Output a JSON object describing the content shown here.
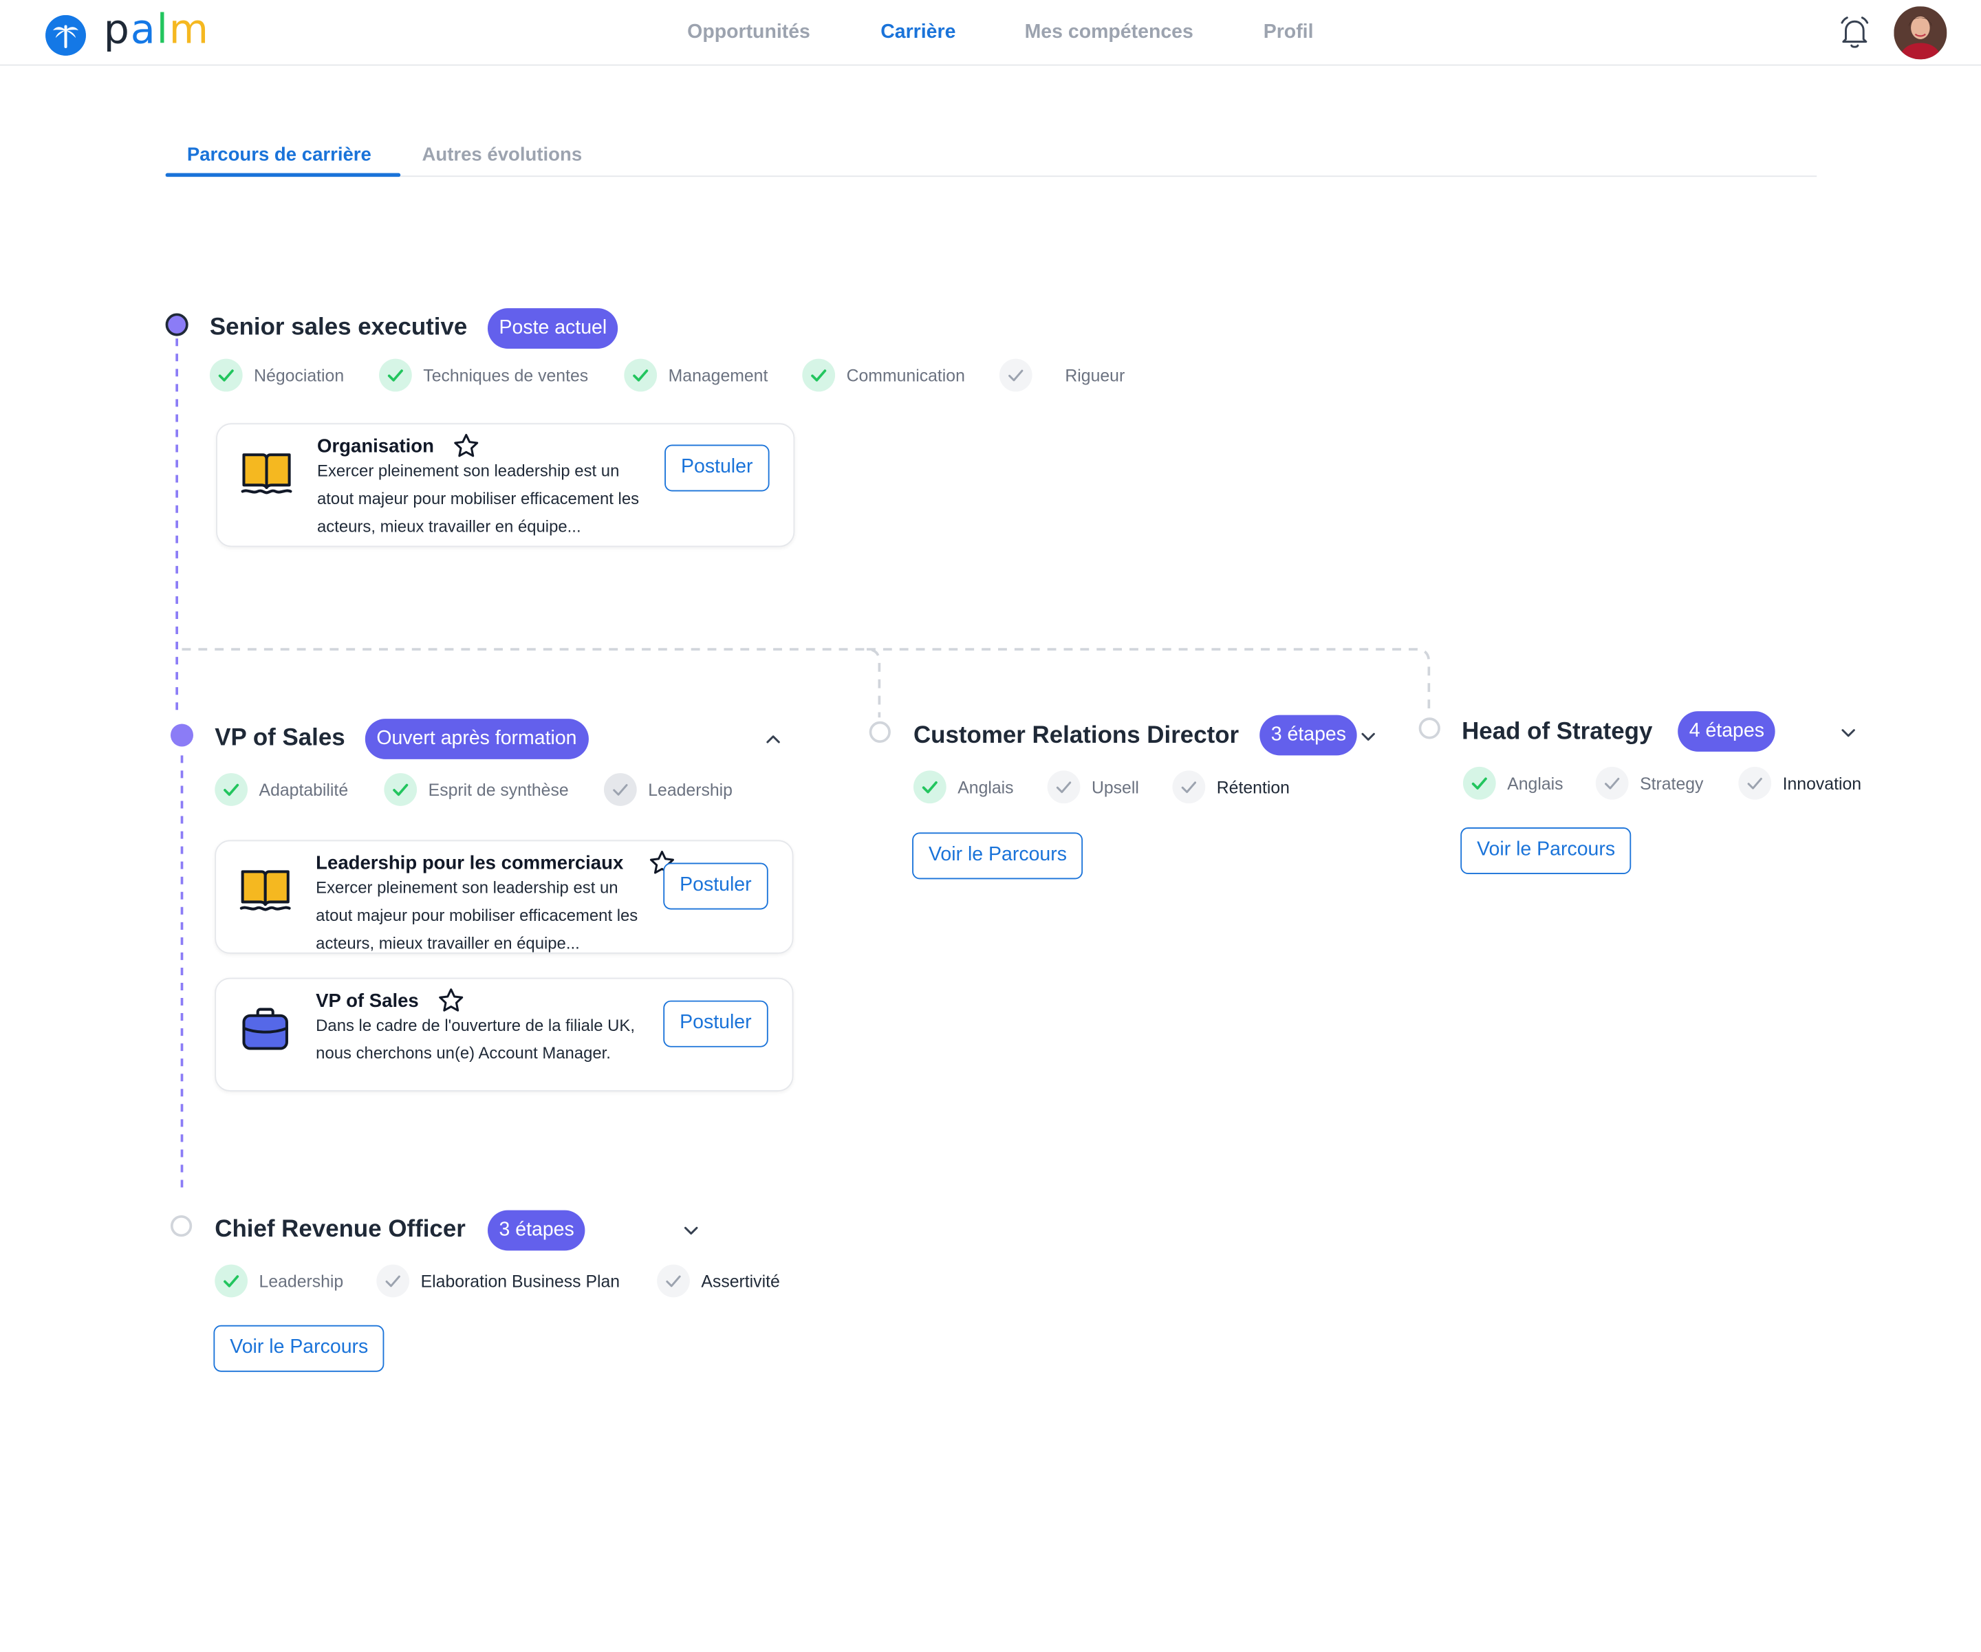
{
  "brand": {
    "logo_text": "palm",
    "logo_letters": [
      "p",
      "a",
      "l",
      "m"
    ],
    "colors": {
      "primary": "#1a73d9",
      "badge": "#6360ec",
      "node": "#8b7cf6",
      "check_bg": "#d6f5e6",
      "check": "#22c55e",
      "book": "#f5b820",
      "briefcase": "#5568e8"
    }
  },
  "nav": {
    "items": [
      {
        "label": "Opportunités",
        "active": false
      },
      {
        "label": "Carrière",
        "active": true
      },
      {
        "label": "Mes compétences",
        "active": false
      },
      {
        "label": "Profil",
        "active": false
      }
    ],
    "notification_icon": "bell-icon",
    "avatar": "user-avatar"
  },
  "tabs": [
    {
      "label": "Parcours de carrière",
      "active": true
    },
    {
      "label": "Autres évolutions",
      "active": false
    }
  ],
  "current": {
    "title": "Senior sales executive",
    "badge": "Poste actuel",
    "skills": [
      {
        "label": "Négociation",
        "acquired": true
      },
      {
        "label": "Techniques de ventes",
        "acquired": true
      },
      {
        "label": "Management",
        "acquired": true
      },
      {
        "label": "Communication",
        "acquired": true
      },
      {
        "label": "Rigueur",
        "acquired": false
      }
    ],
    "cards": [
      {
        "icon": "book-icon",
        "title": "Organisation",
        "description": "Exercer pleinement son leadership est un atout majeur pour mobiliser efficacement les acteurs, mieux travailler en équipe...",
        "action": "Postuler"
      }
    ]
  },
  "vp": {
    "title": "VP of Sales",
    "badge": "Ouvert après formation",
    "expanded": true,
    "skills": [
      {
        "label": "Adaptabilité",
        "acquired": true
      },
      {
        "label": "Esprit de synthèse",
        "acquired": true
      },
      {
        "label": "Leadership",
        "acquired": false
      }
    ],
    "cards": [
      {
        "icon": "book-icon",
        "title": "Leadership pour les commerciaux",
        "description": "Exercer pleinement son leadership est un atout majeur pour mobiliser efficacement les acteurs, mieux travailler en équipe...",
        "action": "Postuler"
      },
      {
        "icon": "briefcase-icon",
        "title": "VP of Sales",
        "description": "Dans le cadre de l'ouverture de la filiale UK, nous cherchons un(e) Account Manager.",
        "action": "Postuler"
      }
    ]
  },
  "crd": {
    "title": "Customer Relations Director",
    "badge": "3 étapes",
    "skills": [
      {
        "label": "Anglais",
        "acquired": true
      },
      {
        "label": "Upsell",
        "acquired": false
      },
      {
        "label": "Rétention",
        "acquired": false
      }
    ],
    "action": "Voir le Parcours"
  },
  "hos": {
    "title": "Head of Strategy",
    "badge": "4 étapes",
    "skills": [
      {
        "label": "Anglais",
        "acquired": true
      },
      {
        "label": "Strategy",
        "acquired": false
      },
      {
        "label": "Innovation",
        "acquired": false
      }
    ],
    "action": "Voir le Parcours"
  },
  "cro": {
    "title": "Chief Revenue Officer",
    "badge": "3 étapes",
    "skills": [
      {
        "label": "Leadership",
        "acquired": true
      },
      {
        "label": "Elaboration Business Plan",
        "acquired": false
      },
      {
        "label": "Assertivité",
        "acquired": false
      }
    ],
    "action": "Voir le Parcours"
  }
}
